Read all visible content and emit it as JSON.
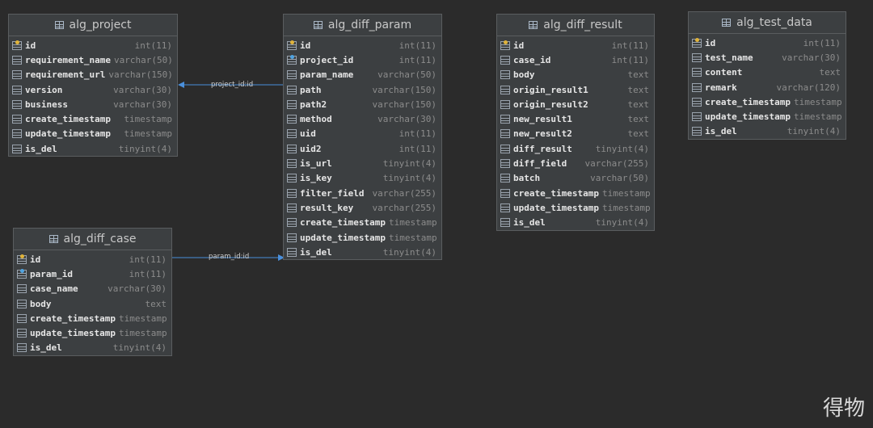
{
  "tables": {
    "alg_project": {
      "name": "alg_project",
      "columns": [
        {
          "name": "id",
          "type": "int(11)",
          "key": "pk"
        },
        {
          "name": "requirement_name",
          "type": "varchar(50)",
          "key": ""
        },
        {
          "name": "requirement_url",
          "type": "varchar(150)",
          "key": ""
        },
        {
          "name": "version",
          "type": "varchar(30)",
          "key": ""
        },
        {
          "name": "business",
          "type": "varchar(30)",
          "key": ""
        },
        {
          "name": "create_timestamp",
          "type": "timestamp",
          "key": ""
        },
        {
          "name": "update_timestamp",
          "type": "timestamp",
          "key": ""
        },
        {
          "name": "is_del",
          "type": "tinyint(4)",
          "key": ""
        }
      ]
    },
    "alg_diff_param": {
      "name": "alg_diff_param",
      "columns": [
        {
          "name": "id",
          "type": "int(11)",
          "key": "pk"
        },
        {
          "name": "project_id",
          "type": "int(11)",
          "key": "fk"
        },
        {
          "name": "param_name",
          "type": "varchar(50)",
          "key": ""
        },
        {
          "name": "path",
          "type": "varchar(150)",
          "key": ""
        },
        {
          "name": "path2",
          "type": "varchar(150)",
          "key": ""
        },
        {
          "name": "method",
          "type": "varchar(30)",
          "key": ""
        },
        {
          "name": "uid",
          "type": "int(11)",
          "key": ""
        },
        {
          "name": "uid2",
          "type": "int(11)",
          "key": ""
        },
        {
          "name": "is_url",
          "type": "tinyint(4)",
          "key": ""
        },
        {
          "name": "is_key",
          "type": "tinyint(4)",
          "key": ""
        },
        {
          "name": "filter_field",
          "type": "varchar(255)",
          "key": ""
        },
        {
          "name": "result_key",
          "type": "varchar(255)",
          "key": ""
        },
        {
          "name": "create_timestamp",
          "type": "timestamp",
          "key": ""
        },
        {
          "name": "update_timestamp",
          "type": "timestamp",
          "key": ""
        },
        {
          "name": "is_del",
          "type": "tinyint(4)",
          "key": ""
        }
      ]
    },
    "alg_diff_result": {
      "name": "alg_diff_result",
      "columns": [
        {
          "name": "id",
          "type": "int(11)",
          "key": "pk"
        },
        {
          "name": "case_id",
          "type": "int(11)",
          "key": ""
        },
        {
          "name": "body",
          "type": "text",
          "key": ""
        },
        {
          "name": "origin_result1",
          "type": "text",
          "key": ""
        },
        {
          "name": "origin_result2",
          "type": "text",
          "key": ""
        },
        {
          "name": "new_result1",
          "type": "text",
          "key": ""
        },
        {
          "name": "new_result2",
          "type": "text",
          "key": ""
        },
        {
          "name": "diff_result",
          "type": "tinyint(4)",
          "key": ""
        },
        {
          "name": "diff_field",
          "type": "varchar(255)",
          "key": ""
        },
        {
          "name": "batch",
          "type": "varchar(50)",
          "key": ""
        },
        {
          "name": "create_timestamp",
          "type": "timestamp",
          "key": ""
        },
        {
          "name": "update_timestamp",
          "type": "timestamp",
          "key": ""
        },
        {
          "name": "is_del",
          "type": "tinyint(4)",
          "key": ""
        }
      ]
    },
    "alg_test_data": {
      "name": "alg_test_data",
      "columns": [
        {
          "name": "id",
          "type": "int(11)",
          "key": "pk"
        },
        {
          "name": "test_name",
          "type": "varchar(30)",
          "key": ""
        },
        {
          "name": "content",
          "type": "text",
          "key": ""
        },
        {
          "name": "remark",
          "type": "varchar(120)",
          "key": ""
        },
        {
          "name": "create_timestamp",
          "type": "timestamp",
          "key": ""
        },
        {
          "name": "update_timestamp",
          "type": "timestamp",
          "key": ""
        },
        {
          "name": "is_del",
          "type": "tinyint(4)",
          "key": ""
        }
      ]
    },
    "alg_diff_case": {
      "name": "alg_diff_case",
      "columns": [
        {
          "name": "id",
          "type": "int(11)",
          "key": "pk"
        },
        {
          "name": "param_id",
          "type": "int(11)",
          "key": "fk"
        },
        {
          "name": "case_name",
          "type": "varchar(30)",
          "key": ""
        },
        {
          "name": "body",
          "type": "text",
          "key": ""
        },
        {
          "name": "create_timestamp",
          "type": "timestamp",
          "key": ""
        },
        {
          "name": "update_timestamp",
          "type": "timestamp",
          "key": ""
        },
        {
          "name": "is_del",
          "type": "tinyint(4)",
          "key": ""
        }
      ]
    }
  },
  "relations": {
    "project_link": "project_id:id",
    "param_link": "param_id:id"
  },
  "watermark": "得物",
  "colors": {
    "background": "#2b2b2b",
    "table_fill": "#3c3f41",
    "link_line": "#4a8fdb",
    "primary_key": "#e0b33a",
    "foreign_key": "#4fa3e0"
  }
}
